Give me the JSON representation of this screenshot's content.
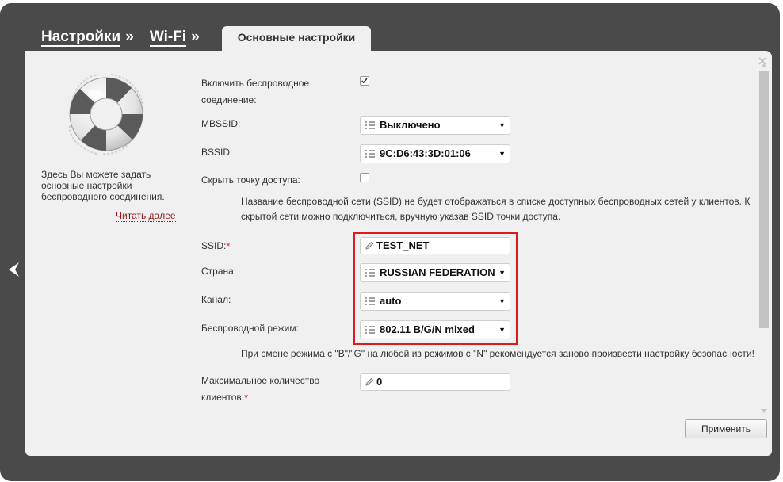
{
  "breadcrumb": {
    "settings": "Настройки",
    "separator": "»",
    "wifi": "Wi-Fi",
    "separator2": "»"
  },
  "tab": {
    "label": "Основные настройки"
  },
  "sidebar": {
    "help_text": "Здесь Вы можете задать основные настройки беспроводного соединения.",
    "read_more": "Читать далее"
  },
  "form": {
    "enable_wireless": {
      "label": "Включить беспроводное соединение:",
      "checked": true
    },
    "mbssid": {
      "label": "MBSSID:",
      "value": "Выключено"
    },
    "bssid": {
      "label": "BSSID:",
      "value": "9C:D6:43:3D:01:06"
    },
    "hide_ap": {
      "label": "Скрыть точку доступа:",
      "checked": false,
      "note": "Название беспроводной сети (SSID) не будет отображаться в списке доступных беспроводных сетей у клиентов. К скрытой сети можно подключиться, вручную указав SSID точки доступа."
    },
    "ssid": {
      "label": "SSID:",
      "required_mark": "*",
      "value": "TEST_NET"
    },
    "country": {
      "label": "Страна:",
      "value": "RUSSIAN FEDERATION"
    },
    "channel": {
      "label": "Канал:",
      "value": "auto"
    },
    "wireless_mode": {
      "label": "Беспроводной режим:",
      "value": "802.11 B/G/N mixed",
      "note": "При смене режима с \"B\"/\"G\" на любой из режимов с \"N\" рекомендуется заново произвести настройку безопасности!"
    },
    "max_clients": {
      "label": "Максимальное количество клиентов:",
      "required_mark": "*",
      "value": "0"
    }
  },
  "buttons": {
    "apply": "Применить"
  },
  "icons": {
    "back": "chevron-left-icon",
    "buoy": "lifebuoy-icon",
    "list": "list-icon",
    "pencil": "pencil-icon",
    "dropdown": "triangle-down-icon",
    "close": "close-icon",
    "scroll_up": "scroll-up-icon",
    "scroll_down": "scroll-down-icon"
  },
  "colors": {
    "frame": "#4a4a4a",
    "panel": "#f0f0f0",
    "highlight_box": "#d91c1c",
    "read_more_link": "#8a1c1c",
    "required": "#e02020"
  }
}
